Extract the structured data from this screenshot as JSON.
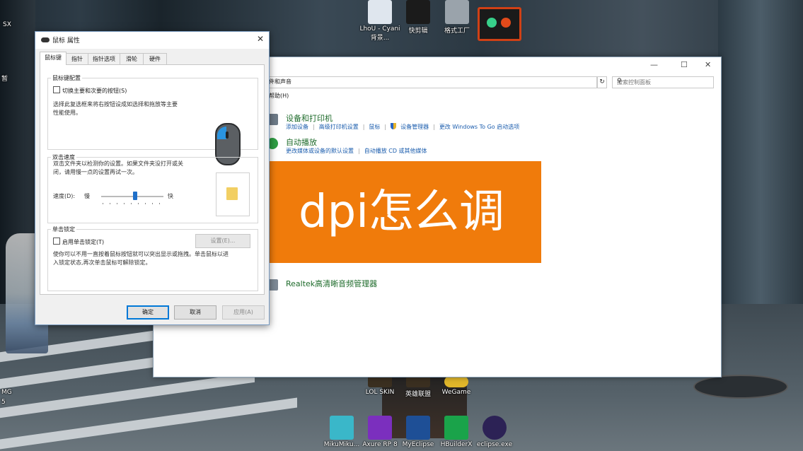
{
  "desktop": {
    "icons_top": [
      {
        "label": "LhoU - Cyani背景...",
        "color": "#dfe6ee"
      },
      {
        "label": "快剪辑",
        "color": "#1b1b1b"
      },
      {
        "label": "格式工厂",
        "color": "#9aa3ab"
      }
    ],
    "icons_middle": [
      {
        "label": "LOL SKIN",
        "color": "#3a2f20"
      },
      {
        "label": "英雄联盟",
        "color": "#3a2f20"
      },
      {
        "label": "WeGame",
        "color": "#e0b62a"
      }
    ],
    "icons_bottom": [
      {
        "label": "MikuMiku...",
        "color": "#3ab7c9"
      },
      {
        "label": "Axure RP 8",
        "color": "#7b2fbe"
      },
      {
        "label": "MyEclipse",
        "color": "#1e4f96"
      },
      {
        "label": "HBuilderX",
        "color": "#1aa34a"
      },
      {
        "label": "eclipse.exe",
        "color": "#2c2255"
      }
    ],
    "left_edge_labels": [
      "SX",
      "暂",
      "MG",
      "5"
    ]
  },
  "control_panel": {
    "title_controls": {
      "minimize": "—",
      "maximize": "☐",
      "close": "✕"
    },
    "address": "件和声音",
    "search_placeholder": "搜索控制面板",
    "menu_help": "帮助(H)",
    "sections": [
      {
        "title": "设备和打印机",
        "icon_color": "#6e7b88",
        "links": [
          "添加设备",
          "高级打印机设置",
          "鼠标",
          "设备管理器",
          "更改 Windows To Go 启动选项"
        ]
      },
      {
        "title": "自动播放",
        "icon_color": "#2f9e44",
        "links": [
          "更改媒体或设备的默认设置",
          "自动播放 CD 或其他媒体"
        ]
      },
      {
        "title": "Realtek高清晰音频管理器",
        "icon_color": "#7e8a96",
        "links": []
      }
    ]
  },
  "banner": {
    "text": "dpi怎么调",
    "color": "#f07b0b"
  },
  "mouse_dialog": {
    "title": "鼠标 属性",
    "close": "✕",
    "tabs": [
      "鼠标键",
      "指针",
      "指针选项",
      "滑轮",
      "硬件"
    ],
    "active_tab": 0,
    "button_config": {
      "group_title": "鼠标键配置",
      "checkbox_label": "切换主要和次要的按钮(S)",
      "description": [
        "选择此复选框来将右按钮设成如选择和拖放等主要",
        "性能使用。"
      ]
    },
    "double_click": {
      "group_title": "双击速度",
      "description": [
        "双击文件夹以检测你的设置。如果文件夹没打开或关",
        "闭，请用慢一点的设置再试一次。"
      ],
      "speed_label": "速度(D):",
      "slow": "慢",
      "fast": "快",
      "speed_value": 0.55
    },
    "click_lock": {
      "group_title": "单击锁定",
      "checkbox_label": "启用单击锁定(T)",
      "settings_button": "设置(E)...",
      "description": [
        "使你可以不用一直按着鼠标按钮就可以突出显示或拖拽。单击鼠标以进",
        "入锁定状态,再次单击鼠标可解除锁定。"
      ]
    },
    "buttons": {
      "ok": "确定",
      "cancel": "取消",
      "apply": "应用(A)"
    }
  }
}
